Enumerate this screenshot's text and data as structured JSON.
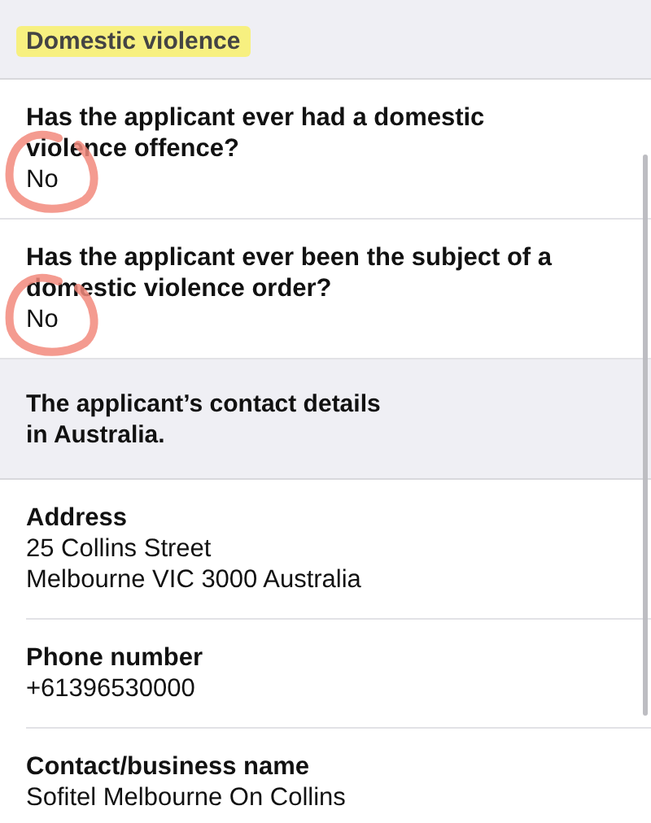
{
  "sections": [
    {
      "title": "Domestic violence",
      "highlighted": true,
      "items": [
        {
          "label": "Has the applicant ever had a domestic violence offence?",
          "lines": [
            "No"
          ],
          "circled": true
        },
        {
          "label": "Has the applicant ever been the subject of a domestic violence order?",
          "lines": [
            "No"
          ],
          "circled": true
        }
      ]
    },
    {
      "title": "The applicant’s contact details in Australia.",
      "highlighted": false,
      "items": [
        {
          "label": "Address",
          "lines": [
            "25 Collins Street",
            "Melbourne VIC 3000 Australia"
          ],
          "circled": false
        },
        {
          "label": "Phone number",
          "lines": [
            "+61396530000"
          ],
          "circled": false
        },
        {
          "label": "Contact/business name",
          "lines": [
            "Sofitel Melbourne On Collins"
          ],
          "circled": false
        }
      ]
    }
  ]
}
